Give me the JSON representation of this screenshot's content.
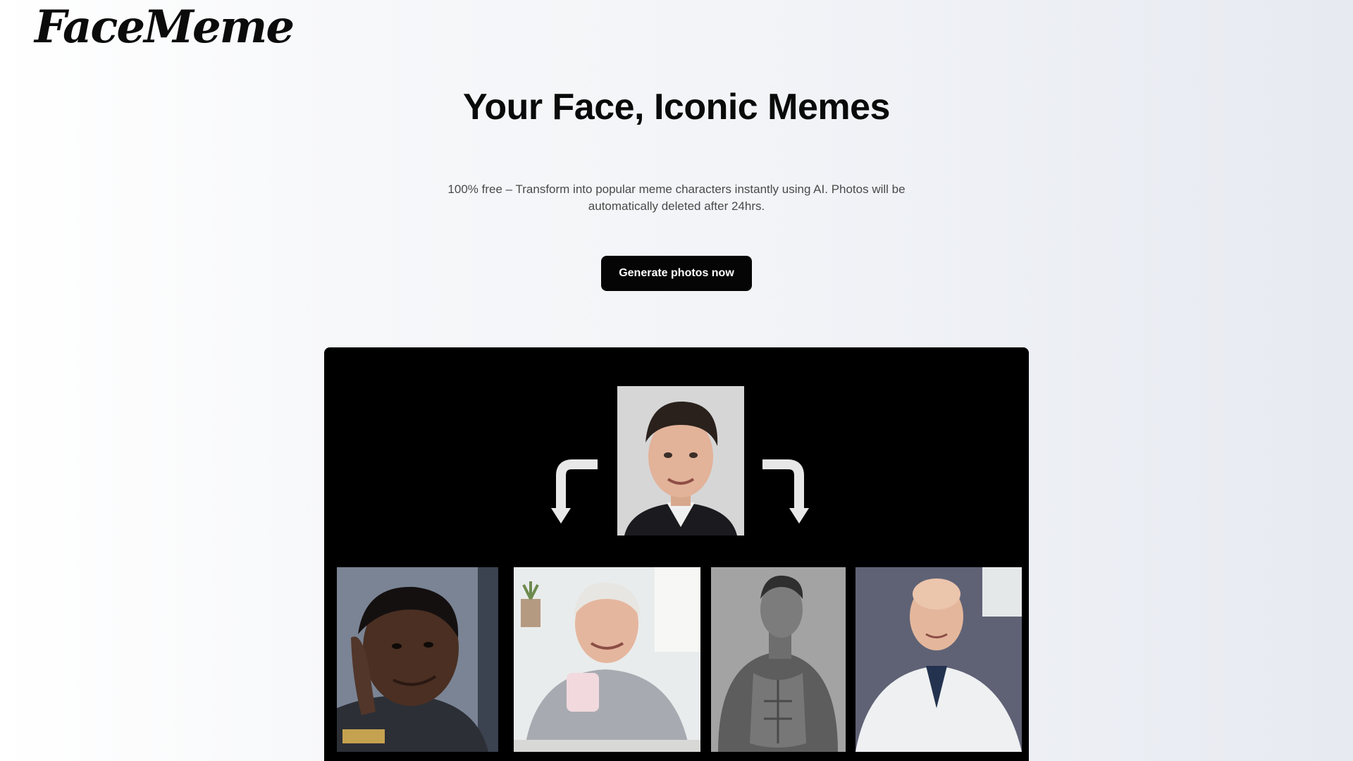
{
  "header": {
    "logo_text": "FaceMeme"
  },
  "hero": {
    "title": "Your Face, Iconic Memes",
    "subtitle": "100% free – Transform into popular meme characters instantly using AI. Photos will be automatically deleted after 24hrs.",
    "cta_label": "Generate photos now"
  },
  "showcase": {
    "source_image": "portrait-photo",
    "result_images": [
      "meme-portrait-1",
      "meme-portrait-2",
      "meme-portrait-3",
      "meme-portrait-4"
    ],
    "arrow_icons": [
      "curved-arrow-down-left-icon",
      "curved-arrow-down-right-icon"
    ]
  },
  "colors": {
    "button_bg": "#050505",
    "button_text": "#ffffff",
    "showcase_bg": "#000000",
    "arrow": "#e8e8e8"
  }
}
